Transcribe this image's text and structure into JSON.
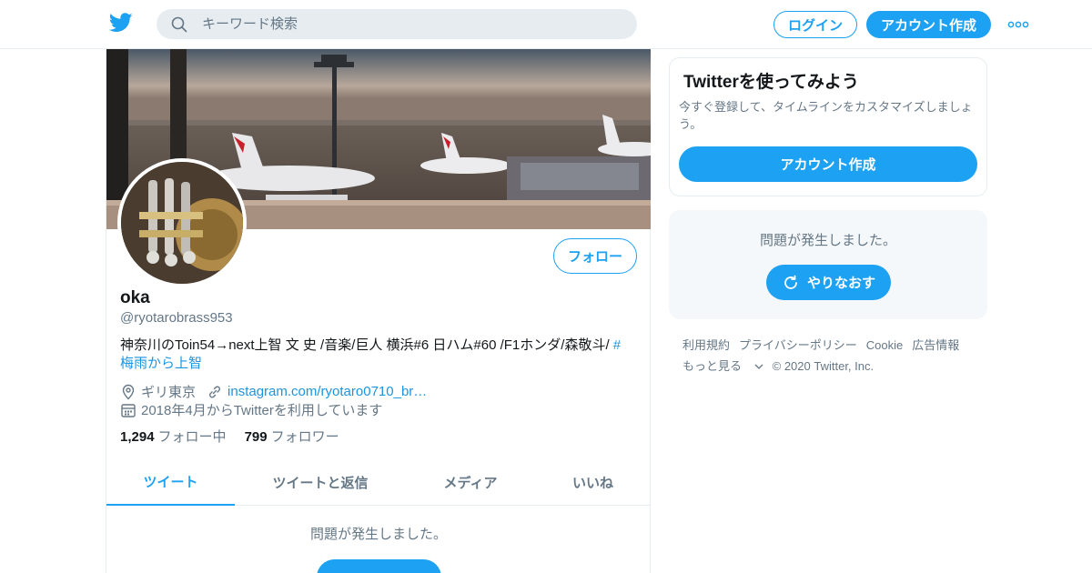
{
  "header": {
    "logo_icon": "twitter-bird-icon",
    "search_placeholder": "キーワード検索",
    "login_label": "ログイン",
    "signup_label": "アカウント作成",
    "more_icon": "more-dots-icon"
  },
  "profile": {
    "follow_label": "フォロー",
    "name": "oka",
    "handle": "@ryotarobrass953",
    "bio_text": "神奈川のToin54→next上智 文 史 /音楽/巨人 横浜#6 日ハム#60 /F1ホンダ/森敬斗/ ",
    "bio_hashtag": "#梅雨から上智",
    "location": "ギリ東京",
    "website": "instagram.com/ryotaro0710_br…",
    "joined": "2018年4月からTwitterを利用しています",
    "following_count": "1,294",
    "following_label": "フォロー中",
    "followers_count": "799",
    "followers_label": "フォロワー"
  },
  "tabs": [
    {
      "label": "ツイート"
    },
    {
      "label": "ツイートと返信"
    },
    {
      "label": "メディア"
    },
    {
      "label": "いいね"
    }
  ],
  "timeline": {
    "error_text": "問題が発生しました。"
  },
  "sidebar": {
    "signup_title": "Twitterを使ってみよう",
    "signup_text": "今すぐ登録して、タイムラインをカスタマイズしましょう。",
    "signup_button": "アカウント作成",
    "error_text": "問題が発生しました。",
    "retry_label": "やりなおす"
  },
  "footer": {
    "links": [
      "利用規約",
      "プライバシーポリシー",
      "Cookie",
      "広告情報"
    ],
    "more_label": "もっと見る",
    "copyright": "© 2020 Twitter, Inc."
  },
  "colors": {
    "accent": "#1da1f2",
    "text_secondary": "#657786",
    "border": "#e6ecf0"
  }
}
